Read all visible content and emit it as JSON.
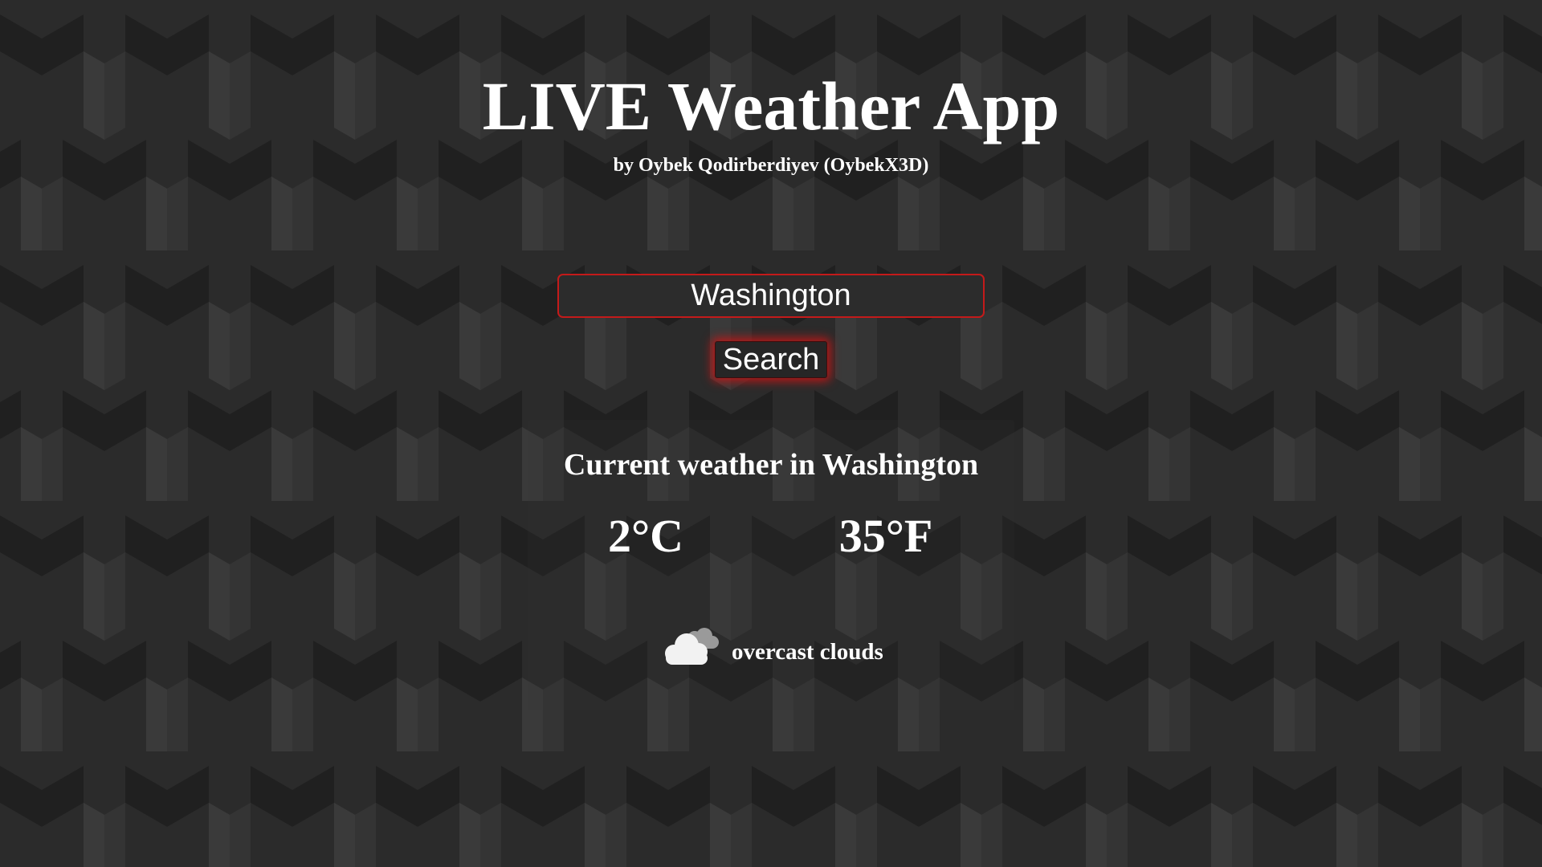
{
  "app": {
    "title": "LIVE Weather App",
    "subtitle": "by Oybek Qodirberdiyev (OybekX3D)"
  },
  "search": {
    "value": "Washington",
    "button_label": "Search"
  },
  "weather": {
    "heading": "Current weather in Washington",
    "temp_c": "2°C",
    "temp_f": "35°F",
    "condition_icon": "cloud-icon",
    "condition": "overcast clouds"
  },
  "colors": {
    "background": "#2a2a2a",
    "accent": "#c41a1a",
    "text": "#ffffff"
  }
}
